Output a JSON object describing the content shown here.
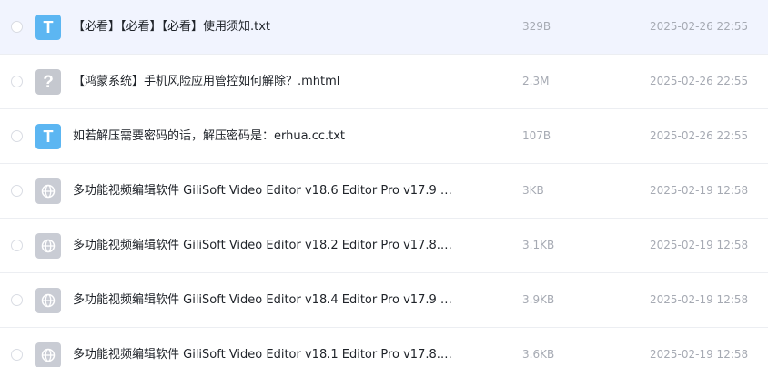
{
  "files": [
    {
      "icon": "txt-file-icon",
      "glyph": "T",
      "name": "【必看】【必看】【必看】使用须知.txt",
      "size": "329B",
      "date": "2025-02-26 22:55"
    },
    {
      "icon": "unknown-file-icon",
      "glyph": "?",
      "name": "【鸿蒙系统】手机风险应用管控如何解除？.mhtml",
      "size": "2.3M",
      "date": "2025-02-26 22:55"
    },
    {
      "icon": "txt-file-icon",
      "glyph": "T",
      "name": "如若解压需要密码的话，解压密码是：erhua.cc.txt",
      "size": "107B",
      "date": "2025-02-26 22:55"
    },
    {
      "icon": "web-file-icon",
      "glyph": "",
      "name": "多功能视频编辑软件 GiliSoft Video Editor v18.6 Editor Pro v17.9 中...",
      "size": "3KB",
      "date": "2025-02-19 12:58"
    },
    {
      "icon": "web-file-icon",
      "glyph": "",
      "name": "多功能视频编辑软件 GiliSoft Video Editor v18.2 Editor Pro v17.8.0 ...",
      "size": "3.1KB",
      "date": "2025-02-19 12:58"
    },
    {
      "icon": "web-file-icon",
      "glyph": "",
      "name": "多功能视频编辑软件 GiliSoft Video Editor v18.4 Editor Pro v17.9 中...",
      "size": "3.9KB",
      "date": "2025-02-19 12:58"
    },
    {
      "icon": "web-file-icon",
      "glyph": "",
      "name": "多功能视频编辑软件 GiliSoft Video Editor v18.1 Editor Pro v17.8.0 ...",
      "size": "3.6KB",
      "date": "2025-02-19 12:58"
    }
  ]
}
